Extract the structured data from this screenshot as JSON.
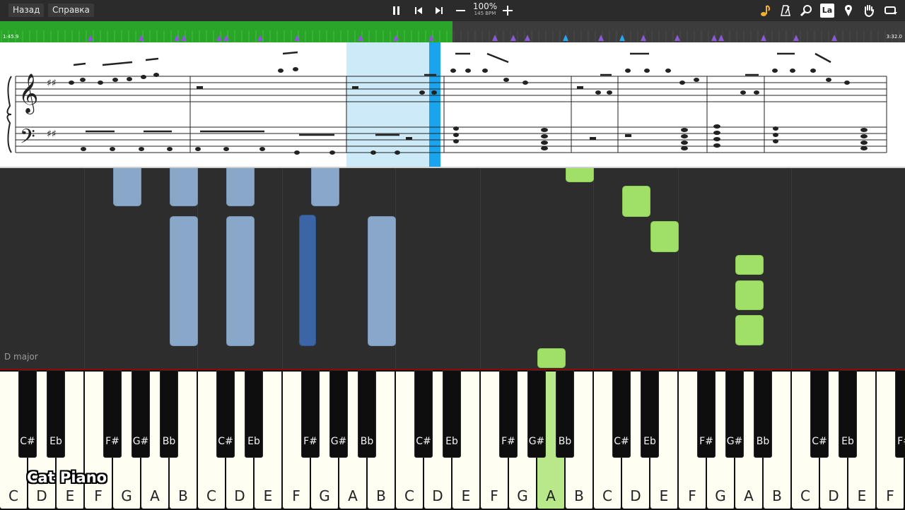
{
  "toolbar": {
    "back_label": "Назад",
    "help_label": "Справка",
    "speed_percent": "100%",
    "bpm": "145 BPM",
    "icons": [
      "pause-icon",
      "skip-back-icon",
      "skip-forward-icon",
      "minus-icon",
      "plus-icon",
      "note-icon",
      "metronome-icon",
      "zoom-icon",
      "la-icon",
      "marker-icon",
      "hand-icon",
      "loop-icon"
    ],
    "la_label": "La"
  },
  "timeline": {
    "elapsed": "1:45.9",
    "total": "3:32.0",
    "progress_fraction": 0.5
  },
  "roll": {
    "key_signature_label": "D major"
  },
  "keyboard": {
    "white_keys": [
      "C",
      "D",
      "E",
      "F",
      "G",
      "A",
      "B",
      "C",
      "D",
      "E",
      "F",
      "G",
      "A",
      "B",
      "C",
      "D",
      "E",
      "F",
      "G",
      "A",
      "B",
      "C",
      "D",
      "E",
      "F",
      "G",
      "A",
      "B",
      "C",
      "D",
      "E",
      "F"
    ],
    "black_keys": [
      "C#",
      "Eb",
      "F#",
      "G#",
      "Bb",
      "C#",
      "Eb",
      "F#",
      "G#",
      "Bb",
      "C#",
      "Eb",
      "F#",
      "G#",
      "Bb",
      "C#",
      "Eb",
      "F#",
      "G#",
      "Bb",
      "C#",
      "Eb",
      "F#"
    ],
    "active_key": "A"
  },
  "watermark": "Cat Piano",
  "colors": {
    "played_track": "#2aa52a",
    "cursor": "#1ba4ee",
    "note_left_hand": "#88a7c9",
    "note_right_hand": "#a0e067"
  }
}
